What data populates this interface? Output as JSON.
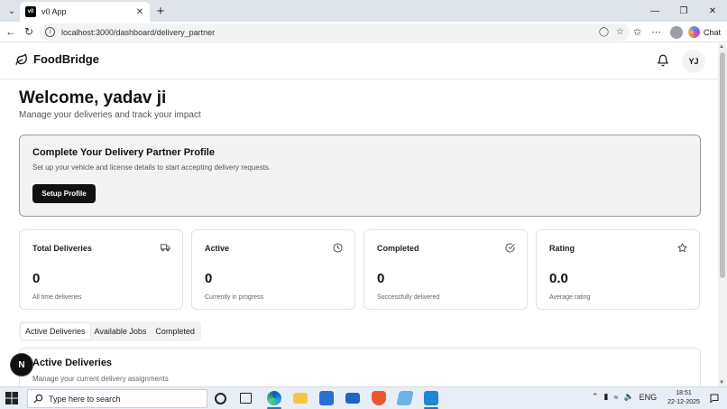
{
  "browser": {
    "tab_title": "v0 App",
    "tab_favicon": "v0",
    "url": "localhost:3000/dashboard/delivery_partner",
    "chat_label": "Chat"
  },
  "app": {
    "brand": "FoodBridge",
    "avatar_initials": "YJ"
  },
  "welcome": {
    "title": "Welcome, yadav ji",
    "subtitle": "Manage your deliveries and track your impact"
  },
  "setup": {
    "title": "Complete Your Delivery Partner Profile",
    "description": "Set up your vehicle and license details to start accepting delivery requests.",
    "button": "Setup Profile"
  },
  "stats": [
    {
      "title": "Total Deliveries",
      "value": "0",
      "sub": "All time deliveries",
      "icon": "truck-icon"
    },
    {
      "title": "Active",
      "value": "0",
      "sub": "Currently in progress",
      "icon": "clock-icon"
    },
    {
      "title": "Completed",
      "value": "0",
      "sub": "Successfully delivered",
      "icon": "check-circle-icon"
    },
    {
      "title": "Rating",
      "value": "0.0",
      "sub": "Average rating",
      "icon": "star-icon"
    }
  ],
  "tabs": [
    "Active Deliveries",
    "Available Jobs",
    "Completed"
  ],
  "section": {
    "title": "Active Deliveries",
    "subtitle": "Manage your current delivery assignments"
  },
  "next_badge": "N",
  "taskbar": {
    "search_placeholder": "Type here to search",
    "language": "ENG",
    "time": "18:51",
    "date": "22-12-2025"
  }
}
